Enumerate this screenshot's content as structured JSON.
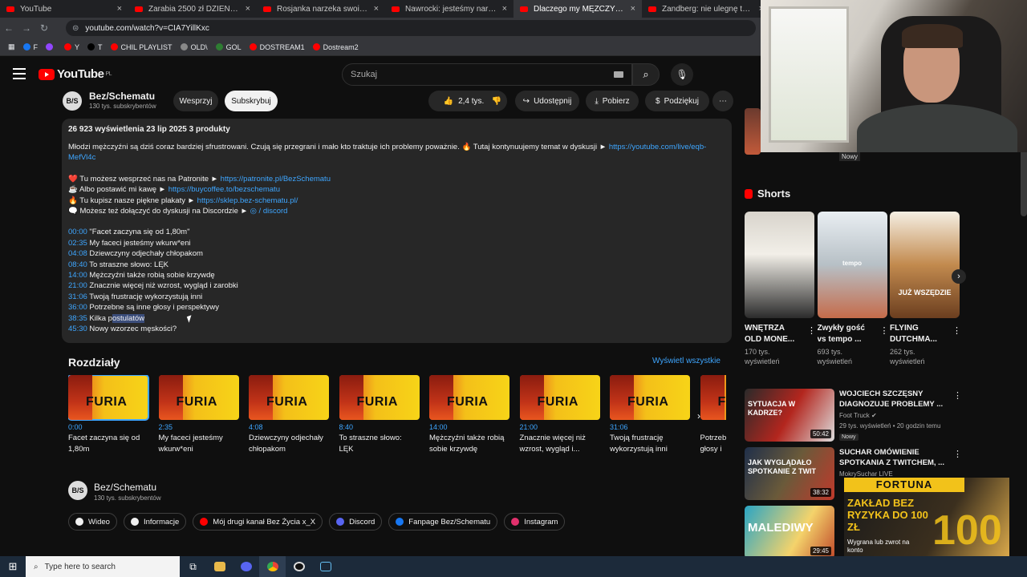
{
  "browser": {
    "tabs": [
      {
        "title": "YouTube"
      },
      {
        "title": "Zarabia 2500 zł DZIENNIE na p…"
      },
      {
        "title": "Rosjanka narzeka swoim rodak…"
      },
      {
        "title": "Nawrocki: jesteśmy narodem, k…"
      },
      {
        "title": "Dlaczego my MĘŻCZYŹNI jeste…"
      },
      {
        "title": "Zandberg: nie ulegnę tej was…"
      }
    ],
    "url": "youtube.com/watch?v=CIA7YillKxc",
    "bookmarks": [
      {
        "label": "F",
        "color": "#1877f2"
      },
      {
        "label": "",
        "color": "#9146ff"
      },
      {
        "label": "Y",
        "color": "#ff0000"
      },
      {
        "label": "T",
        "color": "#000000"
      },
      {
        "label": "CHIL PLAYLIST",
        "color": "#ff0000"
      },
      {
        "label": "OLD\\",
        "color": "#888888"
      },
      {
        "label": "GOL",
        "color": "#2e7d32"
      },
      {
        "label": "DOSTREAM1",
        "color": "#ff0000"
      },
      {
        "label": "Dostream2",
        "color": "#ff0000"
      }
    ]
  },
  "header": {
    "logo": "YouTube",
    "region": "PL",
    "search_placeholder": "Szukaj"
  },
  "channel": {
    "avatar": "B/S",
    "name": "Bez/Schematu",
    "subs": "130 tys. subskrybentów",
    "support": "Wesprzyj",
    "subscribe": "Subskrybuj",
    "likes": "2,4 tys.",
    "share": "Udostępnij",
    "download": "Pobierz",
    "thanks": "Podziękuj"
  },
  "description": {
    "meta": "26 923 wyświetlenia  23 lip 2025  3 produkty",
    "intro": "Młodzi mężczyźni są dziś coraz bardziej sfrustrowani. Czują się przegrani i mało kto traktuje ich problemy poważnie. 🔥 Tutaj kontynuujemy temat w dyskusji ► ",
    "intro_link": "https://youtube.com/live/eqb-",
    "intro_link2": "MefVl4c",
    "support": [
      {
        "text": "❤️ Tu możesz wesprzeć nas na Patronite ► ",
        "link": "https://patronite.pl/BezSchematu"
      },
      {
        "text": "☕ Albo postawić mi kawę ► ",
        "link": "https://buycoffee.to/bezschematu"
      },
      {
        "text": "🔥 Tu kupisz nasze piękne plakaty ► ",
        "link": "https://sklep.bez-schematu.pl/"
      },
      {
        "text": "🗨️ Możesz też dołączyć do dyskusji na Discordzie ► ",
        "link": "◎ / discord"
      }
    ],
    "chapters": [
      {
        "t": "00:00",
        "l": "\"Facet zaczyna się od 1,80m\""
      },
      {
        "t": "02:35",
        "l": "My faceci jesteśmy wkurw*eni"
      },
      {
        "t": "04:08",
        "l": "Dziewczyny odjechały chłopakom"
      },
      {
        "t": "08:40",
        "l": "To straszne słowo: LĘK"
      },
      {
        "t": "14:00",
        "l": "Mężczyźni także robią sobie krzywdę"
      },
      {
        "t": "21:00",
        "l": "Znacznie więcej niż wzrost, wygląd i zarobki"
      },
      {
        "t": "31:06",
        "l": "Twoją frustrację wykorzystują inni"
      },
      {
        "t": "36:00",
        "l": "Potrzebne są inne głosy i perspektywy"
      },
      {
        "t": "38:35",
        "l": "Kilka p",
        "hl": "ostulatów"
      },
      {
        "t": "45:30",
        "l": "Nowy wzorzec męskości?"
      }
    ]
  },
  "chapters_section": {
    "title": "Rozdziały",
    "show_all": "Wyświetl wszystkie",
    "thumb_word": "FURIA",
    "items": [
      {
        "time": "0:00",
        "l1": "Facet zaczyna się od",
        "l2": "1,80m"
      },
      {
        "time": "2:35",
        "l1": "My faceci jesteśmy",
        "l2": "wkurw*eni"
      },
      {
        "time": "4:08",
        "l1": "Dziewczyny odjechały",
        "l2": "chłopakom"
      },
      {
        "time": "8:40",
        "l1": "To straszne słowo:",
        "l2": "LĘK"
      },
      {
        "time": "14:00",
        "l1": "Mężczyźni także robią",
        "l2": "sobie krzywdę"
      },
      {
        "time": "21:00",
        "l1": "Znacznie więcej niż",
        "l2": "wzrost, wygląd i..."
      },
      {
        "time": "31:06",
        "l1": "Twoją frustrację",
        "l2": "wykorzystują inni"
      },
      {
        "time": "",
        "l1": "Potrzeb",
        "l2": "głosy i"
      }
    ]
  },
  "channel_footer": {
    "avatar": "B/S",
    "name": "Bez/Schematu",
    "subs": "130 tys. subskrybentów",
    "links": [
      {
        "label": "Wideo",
        "color": "#f1f1f1"
      },
      {
        "label": "Informacje",
        "color": "#f1f1f1"
      },
      {
        "label": "Mój drugi kanał Bez Życia x_X",
        "color": "#ff0000"
      },
      {
        "label": "Discord",
        "color": "#5865f2"
      },
      {
        "label": "Fanpage Bez/Schematu",
        "color": "#1877f2"
      },
      {
        "label": "Instagram",
        "color": "#e1306c"
      }
    ]
  },
  "sidebar": {
    "top_badge": "Nowy",
    "shorts_title": "Shorts",
    "shorts": [
      {
        "t1": "WNĘTRZA",
        "t2": "OLD MONE...",
        "views": "170 tys.",
        "views2": "wyświetleń"
      },
      {
        "t1": "Zwykły gość",
        "t2": "vs tempo ...",
        "views": "693 tys.",
        "views2": "wyświetleń",
        "overlay": "tempo"
      },
      {
        "t1": "FLYING",
        "t2": "DUTCHMA...",
        "views": "262 tys.",
        "views2": "wyświetleń",
        "overlay": "JUŻ WSZĘDZIE"
      }
    ],
    "videos": [
      {
        "title": "WOJCIECH SZCZĘSNY DIAGNOZUJE PROBLEMY ...",
        "channel": "Foot Truck ✔",
        "meta": "29 tys. wyświetleń • 20 godzin temu",
        "badge": "Nowy",
        "time": "50:42",
        "thumb_text": "SYTUACJA W KADRZE?"
      },
      {
        "title": "SUCHAR OMÓWIENIE SPOTKANIA Z TWITCHEM, ...",
        "channel": "MokrySuchar LIVE",
        "meta": "",
        "badge": "",
        "time": "38:32",
        "thumb_text": "JAK WYGLĄDAŁO SPOTKANIE Z TWIT"
      },
      {
        "title": "",
        "channel": "",
        "meta": "",
        "badge": "",
        "time": "29:45",
        "thumb_text": "MALEDIWY"
      }
    ]
  },
  "ad": {
    "brand": "FORTUNA",
    "headline": "ZAKŁAD BEZ RYZYKA DO 100 ZŁ",
    "small": "Wygrana lub zwrot na konto",
    "big": "100"
  },
  "taskbar": {
    "search": "Type here to search"
  }
}
